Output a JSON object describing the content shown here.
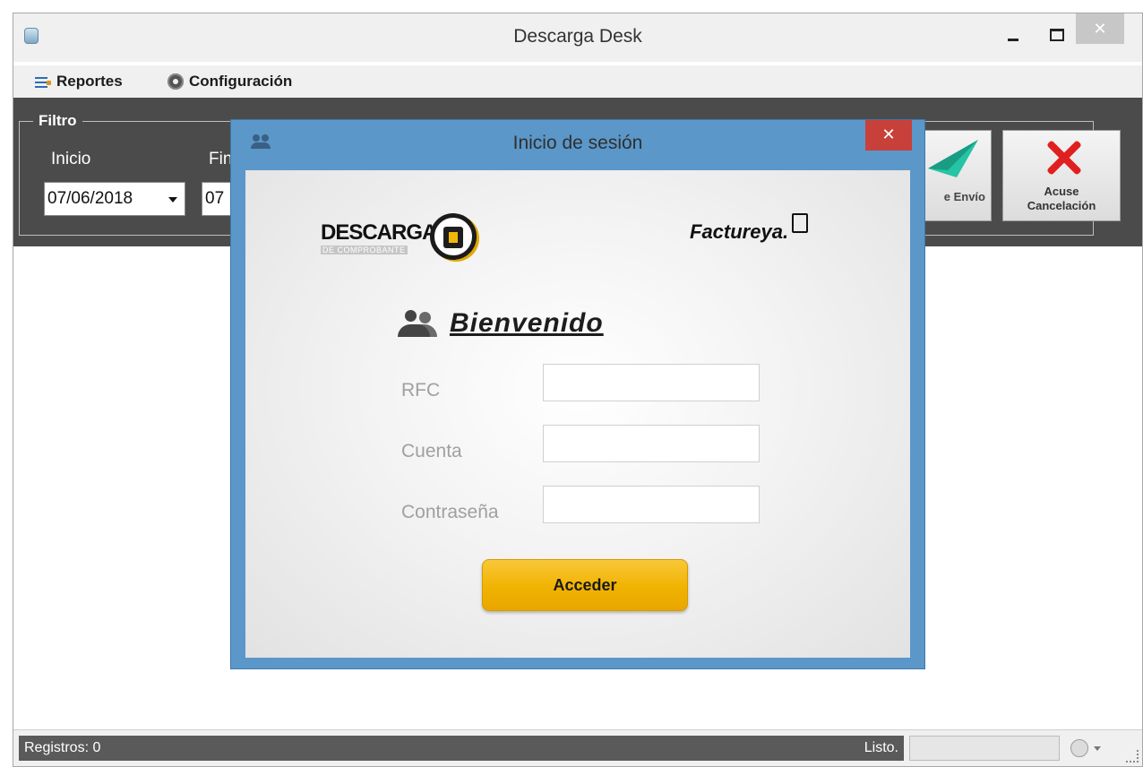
{
  "window": {
    "title": "Descarga Desk",
    "close_glyph": "✕"
  },
  "menu": {
    "reportes": "Reportes",
    "configuracion": "Configuración"
  },
  "filter": {
    "legend": "Filtro",
    "inicio_label": "Inicio",
    "fin_label": "Fin",
    "inicio_value": "07/06/2018",
    "fin_value_partial": "07",
    "envio_label": "e Envío",
    "cancel_label_1": "Acuse",
    "cancel_label_2": "Cancelación"
  },
  "status": {
    "registros": "Registros: 0",
    "ready": "Listo."
  },
  "dialog": {
    "title": "Inicio de sesión",
    "close_glyph": "✕",
    "logo_descarga": "DESCARGA",
    "logo_descarga_sub": "DE COMPROBANTE",
    "logo_factureya": "Factureya.",
    "welcome": "Bienvenido",
    "rfc_label": "RFC",
    "cuenta_label": "Cuenta",
    "password_label": "Contraseña",
    "submit": "Acceder"
  },
  "colors": {
    "dialog_frame": "#5b97c9",
    "filter_bar": "#4b4b4b",
    "accent_button": "#f1b300",
    "dialog_close": "#c8403a"
  },
  "icons": [
    "app-icon",
    "reportes-icon",
    "gear-icon",
    "paper-plane-icon",
    "cancel-x-icon",
    "users-icon",
    "document-icon",
    "hand-icon"
  ]
}
